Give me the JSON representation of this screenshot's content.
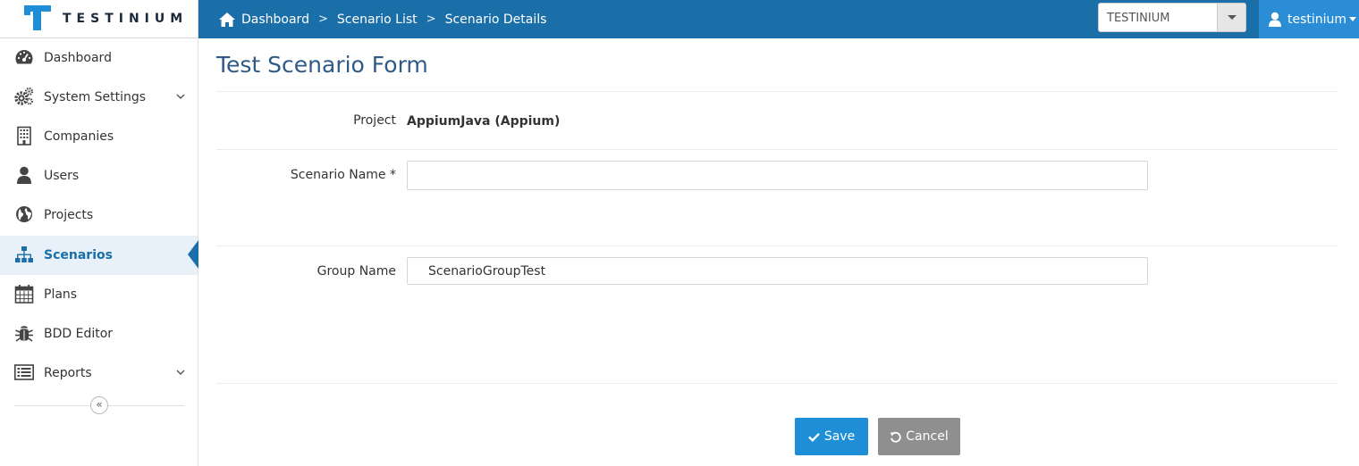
{
  "brand": {
    "name": "TESTINIUM",
    "accent": "#1a6fa8",
    "logo_color": "#1e8fd6"
  },
  "breadcrumb": [
    {
      "label": "Dashboard"
    },
    {
      "label": "Scenario List"
    },
    {
      "label": "Scenario Details"
    }
  ],
  "org_select": {
    "value": "TESTINIUM"
  },
  "user": {
    "name": "testinium"
  },
  "sidebar": {
    "items": [
      {
        "label": "Dashboard",
        "icon": "dashboard-icon",
        "expandable": false
      },
      {
        "label": "System Settings",
        "icon": "gears-icon",
        "expandable": true
      },
      {
        "label": "Companies",
        "icon": "building-icon",
        "expandable": false
      },
      {
        "label": "Users",
        "icon": "user-icon",
        "expandable": false
      },
      {
        "label": "Projects",
        "icon": "globe-icon",
        "expandable": false
      },
      {
        "label": "Scenarios",
        "icon": "sitemap-icon",
        "expandable": false,
        "active": true
      },
      {
        "label": "Plans",
        "icon": "calendar-icon",
        "expandable": false
      },
      {
        "label": "BDD Editor",
        "icon": "bug-icon",
        "expandable": false
      },
      {
        "label": "Reports",
        "icon": "list-icon",
        "expandable": true
      }
    ],
    "collapse_glyph": "«"
  },
  "form": {
    "title": "Test Scenario Form",
    "project_label": "Project",
    "project_value": "AppiumJava (Appium)",
    "scenario_name_label": "Scenario Name *",
    "scenario_name_value": "",
    "group_name_label": "Group Name",
    "group_name_value": "ScenarioGroupTest",
    "save_label": "Save",
    "cancel_label": "Cancel"
  }
}
